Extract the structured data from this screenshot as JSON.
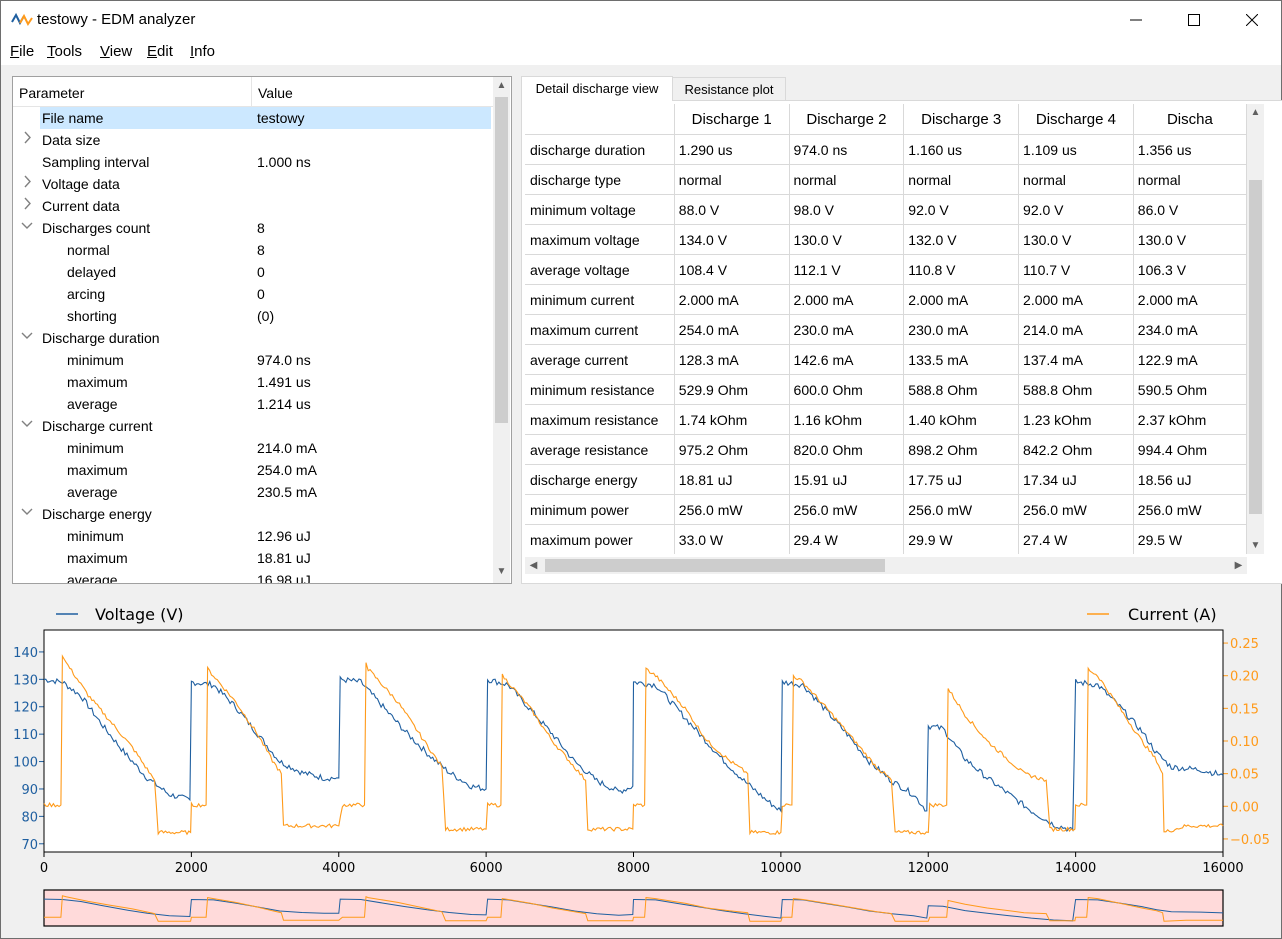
{
  "window": {
    "title": "testowy - EDM analyzer",
    "minimize_glyph": "—",
    "maximize_glyph": "☐",
    "close_glyph": "✕"
  },
  "menu": [
    {
      "label": "File",
      "mnemonic": "F",
      "rest": "ile"
    },
    {
      "label": "Tools",
      "mnemonic": "T",
      "rest": "ools"
    },
    {
      "label": "View",
      "mnemonic": "V",
      "rest": "iew"
    },
    {
      "label": "Edit",
      "mnemonic": "E",
      "rest": "dit"
    },
    {
      "label": "Info",
      "mnemonic": "I",
      "rest": "nfo"
    }
  ],
  "tree": {
    "header_param": "Parameter",
    "header_value": "Value",
    "rows": [
      {
        "key": "File name",
        "value": "testowy",
        "level": 0,
        "arrow": "",
        "selected": true
      },
      {
        "key": "Data size",
        "value": "",
        "level": 0,
        "arrow": "collapsed"
      },
      {
        "key": "Sampling interval",
        "value": "1.000 ns",
        "level": 0,
        "arrow": ""
      },
      {
        "key": "Voltage data",
        "value": "",
        "level": 0,
        "arrow": "collapsed"
      },
      {
        "key": "Current data",
        "value": "",
        "level": 0,
        "arrow": "collapsed"
      },
      {
        "key": "Discharges count",
        "value": "8",
        "level": 0,
        "arrow": "expanded"
      },
      {
        "key": "normal",
        "value": "8",
        "level": 1,
        "arrow": ""
      },
      {
        "key": "delayed",
        "value": "0",
        "level": 1,
        "arrow": ""
      },
      {
        "key": "arcing",
        "value": "0",
        "level": 1,
        "arrow": ""
      },
      {
        "key": "shorting",
        "value": "(0)",
        "level": 1,
        "arrow": ""
      },
      {
        "key": "Discharge duration",
        "value": "",
        "level": 0,
        "arrow": "expanded"
      },
      {
        "key": "minimum",
        "value": "974.0 ns",
        "level": 1,
        "arrow": ""
      },
      {
        "key": "maximum",
        "value": "1.491 us",
        "level": 1,
        "arrow": ""
      },
      {
        "key": "average",
        "value": "1.214 us",
        "level": 1,
        "arrow": ""
      },
      {
        "key": "Discharge current",
        "value": "",
        "level": 0,
        "arrow": "expanded"
      },
      {
        "key": "minimum",
        "value": "214.0 mA",
        "level": 1,
        "arrow": ""
      },
      {
        "key": "maximum",
        "value": "254.0 mA",
        "level": 1,
        "arrow": ""
      },
      {
        "key": "average",
        "value": "230.5 mA",
        "level": 1,
        "arrow": ""
      },
      {
        "key": "Discharge energy",
        "value": "",
        "level": 0,
        "arrow": "expanded"
      },
      {
        "key": "minimum",
        "value": "12.96 uJ",
        "level": 1,
        "arrow": ""
      },
      {
        "key": "maximum",
        "value": "18.81 uJ",
        "level": 1,
        "arrow": ""
      },
      {
        "key": "average",
        "value": "16.98 uJ",
        "level": 1,
        "arrow": ""
      }
    ]
  },
  "tabs": [
    {
      "label": "Detail discharge view",
      "active": true
    },
    {
      "label": "Resistance plot",
      "active": false
    }
  ],
  "table": {
    "columns": [
      "Discharge 1",
      "Discharge 2",
      "Discharge 3",
      "Discharge 4",
      "Discha"
    ],
    "rows": [
      {
        "name": "discharge duration",
        "cells": [
          "1.290 us",
          "974.0 ns",
          "1.160 us",
          "1.109 us",
          "1.356 us"
        ]
      },
      {
        "name": "discharge type",
        "cells": [
          "normal",
          "normal",
          "normal",
          "normal",
          "normal"
        ]
      },
      {
        "name": "minimum voltage",
        "cells": [
          "88.0 V",
          "98.0 V",
          "92.0 V",
          "92.0 V",
          "86.0 V"
        ]
      },
      {
        "name": "maximum voltage",
        "cells": [
          "134.0 V",
          "130.0 V",
          "132.0 V",
          "130.0 V",
          "130.0 V"
        ]
      },
      {
        "name": "average voltage",
        "cells": [
          "108.4 V",
          "112.1 V",
          "110.8 V",
          "110.7 V",
          "106.3 V"
        ]
      },
      {
        "name": "minimum current",
        "cells": [
          "2.000 mA",
          "2.000 mA",
          "2.000 mA",
          "2.000 mA",
          "2.000 mA"
        ]
      },
      {
        "name": "maximum current",
        "cells": [
          "254.0 mA",
          "230.0 mA",
          "230.0 mA",
          "214.0 mA",
          "234.0 mA"
        ]
      },
      {
        "name": "average current",
        "cells": [
          "128.3 mA",
          "142.6 mA",
          "133.5 mA",
          "137.4 mA",
          "122.9 mA"
        ]
      },
      {
        "name": "minimum resistance",
        "cells": [
          "529.9 Ohm",
          "600.0 Ohm",
          "588.8 Ohm",
          "588.8 Ohm",
          "590.5 Ohm"
        ]
      },
      {
        "name": "maximum resistance",
        "cells": [
          "1.74 kOhm",
          "1.16 kOhm",
          "1.40 kOhm",
          "1.23 kOhm",
          "2.37 kOhm"
        ]
      },
      {
        "name": "average resistance",
        "cells": [
          "975.2 Ohm",
          "820.0 Ohm",
          "898.2 Ohm",
          "842.2 Ohm",
          "994.4 Ohm"
        ]
      },
      {
        "name": "discharge energy",
        "cells": [
          "18.81 uJ",
          "15.91 uJ",
          "17.75 uJ",
          "17.34 uJ",
          "18.56 uJ"
        ]
      },
      {
        "name": "minimum power",
        "cells": [
          "256.0 mW",
          "256.0 mW",
          "256.0 mW",
          "256.0 mW",
          "256.0 mW"
        ]
      },
      {
        "name": "maximum power",
        "cells": [
          "33.0 W",
          "29.4 W",
          "29.9 W",
          "27.4 W",
          "29.5 W"
        ]
      }
    ]
  },
  "colors": {
    "voltage": "#1f5fa0",
    "current": "#ff9a1a",
    "selection": "#cce8ff",
    "overview_bg": "#ffdada"
  },
  "chart_data": {
    "type": "line",
    "xlabel": "",
    "xlim": [
      0,
      16000
    ],
    "x_ticks": [
      "0",
      "2000",
      "4000",
      "6000",
      "8000",
      "10000",
      "12000",
      "14000",
      "16000"
    ],
    "y_left_label": "",
    "y_left_lim": [
      67,
      148
    ],
    "y_left_ticks": [
      "140",
      "130",
      "120",
      "110",
      "100",
      "90",
      "80",
      "70"
    ],
    "y_right_lim": [
      -0.07,
      0.27
    ],
    "y_right_ticks": [
      "0.25",
      "0.20",
      "0.15",
      "0.10",
      "0.05",
      "0.00",
      "−0.05"
    ],
    "legend": "top",
    "series": [
      {
        "name": "Voltage (V)",
        "axis": "left",
        "points": [
          [
            0,
            130
          ],
          [
            250,
            129
          ],
          [
            500,
            124
          ],
          [
            800,
            113
          ],
          [
            1100,
            103
          ],
          [
            1400,
            94
          ],
          [
            1700,
            88
          ],
          [
            1980,
            86
          ],
          [
            2000,
            129
          ],
          [
            2300,
            128
          ],
          [
            2600,
            120
          ],
          [
            2900,
            110
          ],
          [
            3200,
            100
          ],
          [
            3500,
            96
          ],
          [
            3800,
            94
          ],
          [
            4000,
            94
          ],
          [
            4020,
            130
          ],
          [
            4300,
            129
          ],
          [
            4600,
            120
          ],
          [
            4900,
            111
          ],
          [
            5200,
            103
          ],
          [
            5500,
            96
          ],
          [
            5800,
            91
          ],
          [
            6000,
            90
          ],
          [
            6020,
            130
          ],
          [
            6300,
            128
          ],
          [
            6600,
            119
          ],
          [
            6900,
            110
          ],
          [
            7200,
            100
          ],
          [
            7500,
            93
          ],
          [
            7800,
            89
          ],
          [
            7990,
            91
          ],
          [
            8000,
            129
          ],
          [
            8300,
            128
          ],
          [
            8600,
            119
          ],
          [
            8900,
            110
          ],
          [
            9200,
            101
          ],
          [
            9500,
            93
          ],
          [
            9800,
            86
          ],
          [
            10000,
            82
          ],
          [
            10020,
            129
          ],
          [
            10300,
            128
          ],
          [
            10600,
            119
          ],
          [
            10900,
            110
          ],
          [
            11200,
            100
          ],
          [
            11500,
            93
          ],
          [
            11800,
            88
          ],
          [
            11980,
            82
          ],
          [
            12000,
            113
          ],
          [
            12200,
            112
          ],
          [
            12500,
            101
          ],
          [
            12800,
            94
          ],
          [
            13100,
            88
          ],
          [
            13400,
            82
          ],
          [
            13700,
            77
          ],
          [
            13960,
            75
          ],
          [
            14000,
            129
          ],
          [
            14300,
            128
          ],
          [
            14600,
            120
          ],
          [
            14900,
            111
          ],
          [
            15100,
            103
          ],
          [
            15300,
            98
          ],
          [
            15700,
            97
          ],
          [
            16000,
            95
          ]
        ]
      },
      {
        "name": "Current (A)",
        "axis": "right",
        "points": [
          [
            0,
            0.002
          ],
          [
            230,
            0.002
          ],
          [
            250,
            0.23
          ],
          [
            300,
            0.22
          ],
          [
            600,
            0.17
          ],
          [
            900,
            0.13
          ],
          [
            1200,
            0.09
          ],
          [
            1500,
            0.04
          ],
          [
            1550,
            -0.04
          ],
          [
            1990,
            -0.04
          ],
          [
            2000,
            0.002
          ],
          [
            2200,
            0.002
          ],
          [
            2220,
            0.21
          ],
          [
            2300,
            0.2
          ],
          [
            2600,
            0.16
          ],
          [
            2900,
            0.11
          ],
          [
            3100,
            0.07
          ],
          [
            3220,
            0.05
          ],
          [
            3250,
            -0.03
          ],
          [
            4000,
            -0.03
          ],
          [
            4050,
            0.002
          ],
          [
            4350,
            0.002
          ],
          [
            4370,
            0.22
          ],
          [
            4400,
            0.21
          ],
          [
            4800,
            0.16
          ],
          [
            5100,
            0.11
          ],
          [
            5400,
            0.06
          ],
          [
            5450,
            -0.035
          ],
          [
            6000,
            -0.035
          ],
          [
            6020,
            0.002
          ],
          [
            6200,
            0.002
          ],
          [
            6220,
            0.2
          ],
          [
            6300,
            0.19
          ],
          [
            6600,
            0.15
          ],
          [
            6900,
            0.1
          ],
          [
            7200,
            0.06
          ],
          [
            7350,
            0.04
          ],
          [
            7380,
            -0.035
          ],
          [
            7990,
            -0.035
          ],
          [
            8000,
            0.002
          ],
          [
            8150,
            0.002
          ],
          [
            8170,
            0.21
          ],
          [
            8300,
            0.2
          ],
          [
            8700,
            0.15
          ],
          [
            9000,
            0.1
          ],
          [
            9300,
            0.07
          ],
          [
            9550,
            0.05
          ],
          [
            9580,
            -0.04
          ],
          [
            10000,
            -0.04
          ],
          [
            10020,
            0.002
          ],
          [
            10150,
            0.002
          ],
          [
            10170,
            0.2
          ],
          [
            10300,
            0.19
          ],
          [
            10700,
            0.14
          ],
          [
            11000,
            0.1
          ],
          [
            11300,
            0.06
          ],
          [
            11500,
            0.04
          ],
          [
            11550,
            -0.04
          ],
          [
            12000,
            -0.04
          ],
          [
            12020,
            0.002
          ],
          [
            12250,
            0.002
          ],
          [
            12270,
            0.18
          ],
          [
            12500,
            0.14
          ],
          [
            12800,
            0.1
          ],
          [
            13100,
            0.07
          ],
          [
            13300,
            0.05
          ],
          [
            13600,
            0.04
          ],
          [
            13650,
            -0.035
          ],
          [
            13990,
            -0.035
          ],
          [
            14000,
            0.002
          ],
          [
            14150,
            0.002
          ],
          [
            14170,
            0.21
          ],
          [
            14300,
            0.2
          ],
          [
            14600,
            0.15
          ],
          [
            14900,
            0.1
          ],
          [
            15100,
            0.07
          ],
          [
            15180,
            0.05
          ],
          [
            15200,
            -0.04
          ],
          [
            15500,
            -0.03
          ],
          [
            16000,
            -0.03
          ]
        ]
      }
    ]
  }
}
